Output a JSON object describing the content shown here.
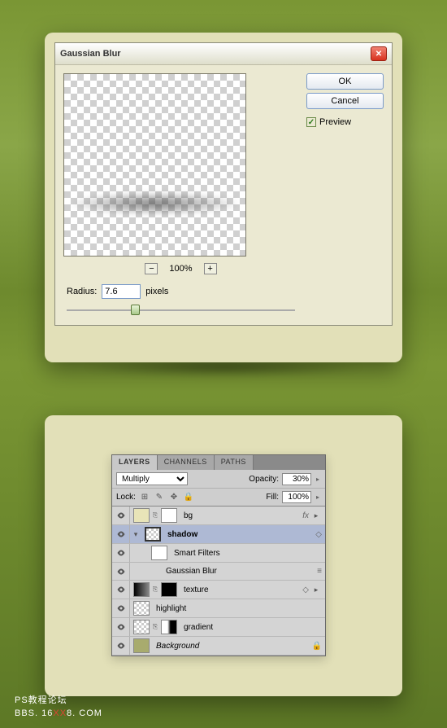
{
  "dialog": {
    "title": "Gaussian Blur",
    "ok": "OK",
    "cancel": "Cancel",
    "preview": "Preview",
    "zoom": "100%",
    "radius_label": "Radius:",
    "radius_value": "7.6",
    "radius_unit": "pixels"
  },
  "layers": {
    "tabs": [
      "LAYERS",
      "CHANNELS",
      "PATHS"
    ],
    "blend": "Multiply",
    "opacity_label": "Opacity:",
    "opacity": "30%",
    "lock_label": "Lock:",
    "fill_label": "Fill:",
    "fill": "100%",
    "rows": {
      "bg": "bg",
      "shadow": "shadow",
      "smart": "Smart Filters",
      "gauss": "Gaussian Blur",
      "texture": "texture",
      "highlight": "highlight",
      "gradient": "gradient",
      "background": "Background"
    },
    "fx": "fx"
  },
  "footer": {
    "line1": "PS教程论坛",
    "line2a": "BBS. 16",
    "line2b": "XX",
    "line2c": "8. COM"
  }
}
